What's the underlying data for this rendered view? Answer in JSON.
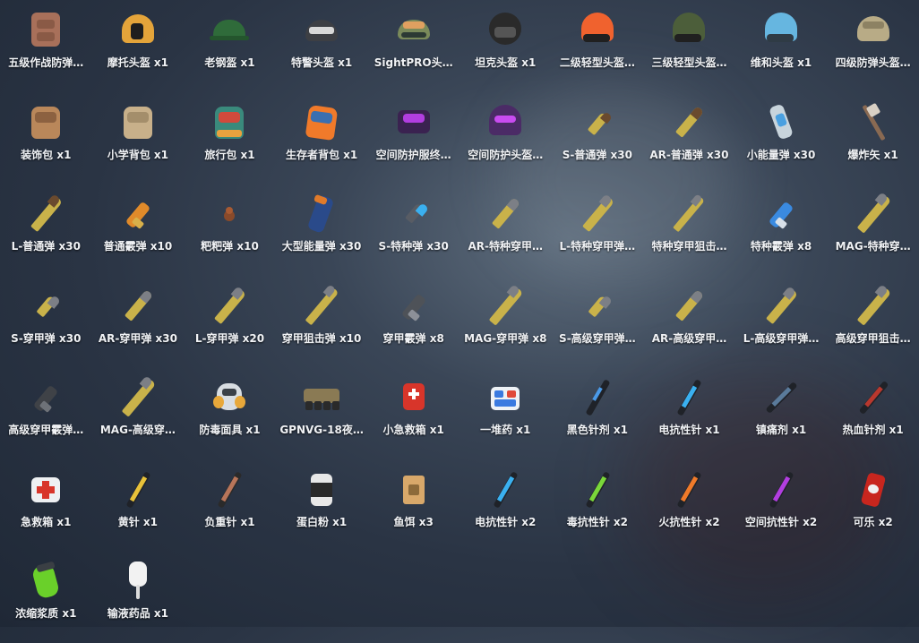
{
  "items": [
    {
      "label": "五级作战防弹…",
      "icon": "armor-vest-icon"
    },
    {
      "label": "摩托头盔 x1",
      "icon": "motorcycle-helmet-icon"
    },
    {
      "label": "老钢盔 x1",
      "icon": "steel-helmet-icon"
    },
    {
      "label": "特警头盔 x1",
      "icon": "swat-helmet-icon"
    },
    {
      "label": "SightPRO头…",
      "icon": "sightpro-helmet-icon"
    },
    {
      "label": "坦克头盔 x1",
      "icon": "tank-helmet-icon"
    },
    {
      "label": "二级轻型头盔…",
      "icon": "light-helmet-orange-icon"
    },
    {
      "label": "三级轻型头盔…",
      "icon": "light-helmet-green-icon"
    },
    {
      "label": "维和头盔 x1",
      "icon": "peacekeeper-helmet-icon"
    },
    {
      "label": "四级防弹头盔…",
      "icon": "bulletproof-helmet-icon"
    },
    {
      "label": "装饰包 x1",
      "icon": "decor-bag-icon"
    },
    {
      "label": "小学背包 x1",
      "icon": "school-backpack-icon"
    },
    {
      "label": "旅行包 x1",
      "icon": "travel-bag-icon"
    },
    {
      "label": "生存者背包 x1",
      "icon": "survivor-backpack-icon"
    },
    {
      "label": "空间防护服终…",
      "icon": "space-suit-icon"
    },
    {
      "label": "空间防护头盔…",
      "icon": "space-helmet-icon"
    },
    {
      "label": "S-普通弹 x30",
      "icon": "bullet-icon"
    },
    {
      "label": "AR-普通弹 x30",
      "icon": "bullet-icon"
    },
    {
      "label": "小能量弹 x30",
      "icon": "energy-cell-icon"
    },
    {
      "label": "爆炸矢 x1",
      "icon": "explosive-bolt-icon"
    },
    {
      "label": "L-普通弹 x30",
      "icon": "bullet-icon"
    },
    {
      "label": "普通霰弹 x10",
      "icon": "shotgun-shell-icon"
    },
    {
      "label": "粑粑弹 x10",
      "icon": "poop-round-icon"
    },
    {
      "label": "大型能量弹 x30",
      "icon": "large-energy-cell-icon"
    },
    {
      "label": "S-特种弹 x30",
      "icon": "special-bullet-icon"
    },
    {
      "label": "AR-特种穿甲…",
      "icon": "bullet-icon"
    },
    {
      "label": "L-特种穿甲弹…",
      "icon": "bullet-icon"
    },
    {
      "label": "特种穿甲狙击…",
      "icon": "sniper-bullet-icon"
    },
    {
      "label": "特种霰弹 x8",
      "icon": "special-shell-icon"
    },
    {
      "label": "MAG-特种穿…",
      "icon": "sniper-bullet-icon"
    },
    {
      "label": "S-穿甲弹 x30",
      "icon": "bullet-icon"
    },
    {
      "label": "AR-穿甲弹 x30",
      "icon": "bullet-icon"
    },
    {
      "label": "L-穿甲弹 x20",
      "icon": "bullet-icon"
    },
    {
      "label": "穿甲狙击弹 x10",
      "icon": "sniper-bullet-icon"
    },
    {
      "label": "穿甲霰弹 x8",
      "icon": "shotgun-shell-icon"
    },
    {
      "label": "MAG-穿甲弹 x8",
      "icon": "sniper-bullet-icon"
    },
    {
      "label": "S-高级穿甲弹…",
      "icon": "bullet-icon"
    },
    {
      "label": "AR-高级穿甲…",
      "icon": "bullet-icon"
    },
    {
      "label": "L-高级穿甲弹…",
      "icon": "bullet-icon"
    },
    {
      "label": "高级穿甲狙击…",
      "icon": "sniper-bullet-icon"
    },
    {
      "label": "高级穿甲霰弹…",
      "icon": "shotgun-shell-icon"
    },
    {
      "label": "MAG-高级穿…",
      "icon": "sniper-bullet-icon"
    },
    {
      "label": "防毒面具 x1",
      "icon": "gas-mask-icon"
    },
    {
      "label": "GPNVG-18夜…",
      "icon": "night-vision-icon"
    },
    {
      "label": "小急救箱 x1",
      "icon": "small-medkit-icon"
    },
    {
      "label": "一堆药 x1",
      "icon": "pill-box-icon"
    },
    {
      "label": "黑色针剂 x1",
      "icon": "syringe-icon"
    },
    {
      "label": "电抗性针 x1",
      "icon": "syringe-icon"
    },
    {
      "label": "镇痛剂 x1",
      "icon": "syringe-icon"
    },
    {
      "label": "热血针剂 x1",
      "icon": "syringe-icon"
    },
    {
      "label": "急救箱 x1",
      "icon": "medkit-icon"
    },
    {
      "label": "黄针 x1",
      "icon": "syringe-icon"
    },
    {
      "label": "负重针 x1",
      "icon": "syringe-icon"
    },
    {
      "label": "蛋白粉 x1",
      "icon": "protein-can-icon"
    },
    {
      "label": "鱼饵 x3",
      "icon": "bait-bag-icon"
    },
    {
      "label": "电抗性针 x2",
      "icon": "syringe-icon"
    },
    {
      "label": "毒抗性针 x2",
      "icon": "syringe-icon"
    },
    {
      "label": "火抗性针 x2",
      "icon": "syringe-icon"
    },
    {
      "label": "空间抗性针 x2",
      "icon": "syringe-icon"
    },
    {
      "label": "可乐 x2",
      "icon": "cola-can-icon"
    },
    {
      "label": "浓缩浆质 x1",
      "icon": "plasma-capsule-icon"
    },
    {
      "label": "输液药品 x1",
      "icon": "iv-drip-icon"
    }
  ],
  "colors": {
    "text": "#f0f2f5",
    "brass": "#c9b24a",
    "steel_tip": "#7c7f86"
  }
}
